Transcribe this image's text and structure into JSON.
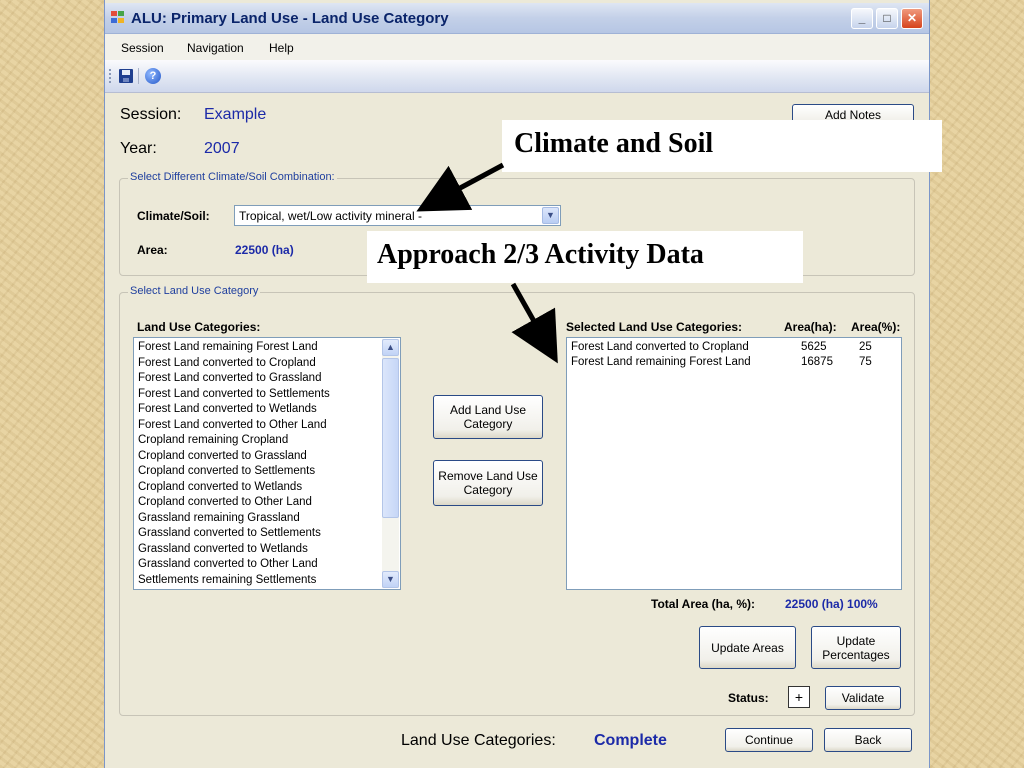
{
  "window": {
    "title": "ALU: Primary Land Use - Land Use Category",
    "minimize_icon": "minimize-icon",
    "maximize_icon": "maximize-icon",
    "close_icon": "close-icon"
  },
  "menu": [
    "Session",
    "Navigation",
    "Help"
  ],
  "toolbar": {
    "icons": [
      "save-icon",
      "help-icon"
    ]
  },
  "session": {
    "label": "Session:",
    "value": "Example"
  },
  "year": {
    "label": "Year:",
    "value": "2007"
  },
  "add_notes_label": "Add Notes",
  "climate_group": {
    "title": "Select Different Climate/Soil Combination:",
    "climate_label": "Climate/Soil:",
    "climate_value": "Tropical, wet/Low activity mineral  -",
    "area_label": "Area:",
    "area_value": "22500 (ha)"
  },
  "land_use_group": {
    "title": "Select Land Use Category",
    "list_header": "Land Use Categories:",
    "categories": [
      "Forest Land remaining Forest Land",
      "Forest Land converted to Cropland",
      "Forest Land converted to Grassland",
      "Forest Land converted to Settlements",
      "Forest Land converted to Wetlands",
      "Forest Land converted to Other Land",
      "Cropland remaining Cropland",
      "Cropland converted to Grassland",
      "Cropland converted to Settlements",
      "Cropland converted to Wetlands",
      "Cropland converted to Other Land",
      "Grassland remaining Grassland",
      "Grassland converted to Settlements",
      "Grassland converted to Wetlands",
      "Grassland converted to Other Land",
      "Settlements remaining Settlements"
    ],
    "add_button": "Add Land Use Category",
    "remove_button": "Remove Land Use Category",
    "selected_header": "Selected Land Use Categories:",
    "area_ha_header": "Area(ha):",
    "area_pct_header": "Area(%):",
    "selected": [
      {
        "name": "Forest Land converted to Cropland",
        "area_ha": "5625",
        "area_pct": "25"
      },
      {
        "name": "Forest Land remaining Forest Land",
        "area_ha": "16875",
        "area_pct": "75"
      }
    ],
    "total_label": "Total Area (ha, %):",
    "total_value": "22500 (ha) 100%",
    "update_areas": "Update Areas",
    "update_percentages": "Update Percentages",
    "status_label": "Status:",
    "status_value": "+",
    "validate": "Validate"
  },
  "footer": {
    "label": "Land Use Categories:",
    "value": "Complete",
    "continue": "Continue",
    "back": "Back"
  },
  "callouts": {
    "climate_soil": "Climate and Soil",
    "activity_data": "Approach 2/3 Activity Data"
  }
}
